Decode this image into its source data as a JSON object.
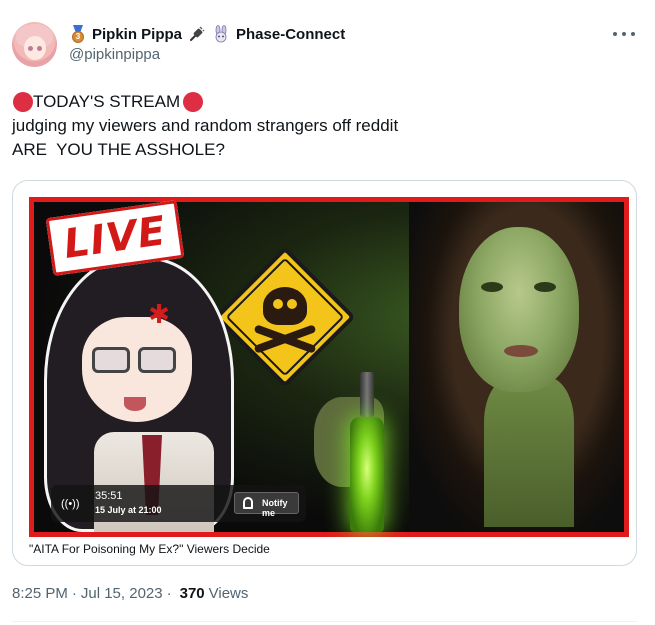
{
  "author": {
    "display_name": "Pipkin Pippa",
    "affiliation": "Phase-Connect",
    "handle": "@pipkinpippa",
    "medal_number": "3"
  },
  "tweet": {
    "line1": "TODAY'S STREAM",
    "line2": "judging my viewers and random strangers off reddit",
    "line3": "ARE  YOU THE ASSHOLE?"
  },
  "media": {
    "live_label": "LIVE",
    "stream_time": "35:51",
    "stream_date": "15 July at 21:00",
    "notify_label": "Notify me",
    "caption": "\"AITA For Poisoning My Ex?\" Viewers Decide"
  },
  "meta": {
    "time": "8:25 PM",
    "date": "Jul 15, 2023",
    "views_count": "370",
    "views_label": "Views"
  },
  "icons": {
    "more": "more-options-icon",
    "medal": "medal-icon",
    "plug": "plug-icon",
    "bunny": "bunny-icon",
    "red_circle": "red-circle-emoji-icon",
    "broadcast": "broadcast-icon",
    "bell": "bell-icon"
  },
  "colors": {
    "text_primary": "#0f1419",
    "text_secondary": "#536471",
    "red_emoji": "#dd2e44",
    "thumb_border": "#e01b1b"
  }
}
